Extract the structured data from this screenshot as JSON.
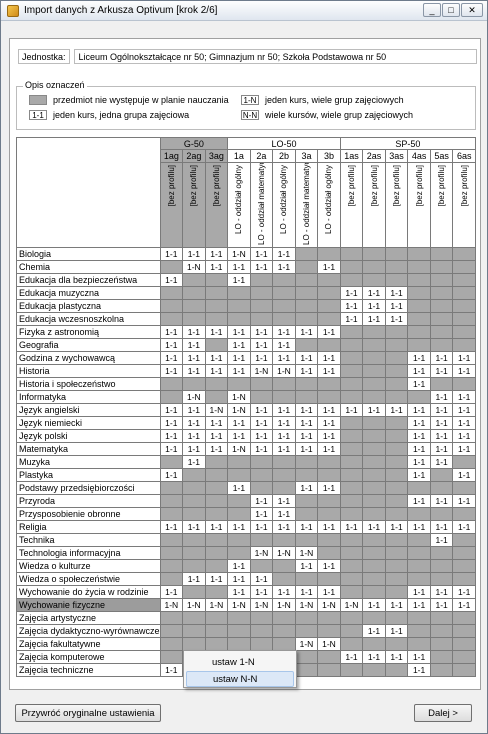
{
  "window": {
    "title": "Import danych z Arkusza Optivum [krok 2/6]",
    "min": "_",
    "max": "□",
    "close": "✕"
  },
  "jednostka": {
    "label": "Jednostka:",
    "value": "Liceum Ogólnokształcące nr 50; Gimnazjum nr 50; Szkoła Podstawowa nr 50"
  },
  "legend": {
    "title": "Opis oznaczeń",
    "grey_text": "przedmiot nie występuje w planie nauczania",
    "one_one_box": "1-1",
    "one_one_text": "jeden kurs, jedna grupa zajęciowa",
    "one_n_box": "1-N",
    "one_n_text": "jeden kurs, wiele grup zajęciowych",
    "n_n_box": "N-N",
    "n_n_text": "wiele kursów, wiele grup zajęciowych"
  },
  "groups": [
    {
      "name": "G-50",
      "span": 3,
      "grey": true
    },
    {
      "name": "LO-50",
      "span": 5,
      "grey": false
    },
    {
      "name": "SP-50",
      "span": 6,
      "grey": false
    }
  ],
  "classes": [
    "1ag",
    "2ag",
    "3ag",
    "1a",
    "2a",
    "2b",
    "3a",
    "3b",
    "1as",
    "2as",
    "3as",
    "4as",
    "5as",
    "6as"
  ],
  "profiles": [
    "[bez profilu]",
    "[bez profilu]",
    "[bez profilu]",
    "LO - oddział ogólny",
    "LO - oddział matematyczny",
    "LO - oddział ogólny",
    "LO - oddział matematyczny",
    "LO - oddział ogólny",
    "[bez profilu]",
    "[bez profilu]",
    "[bez profilu]",
    "[bez profilu]",
    "[bez profilu]",
    "[bez profilu]"
  ],
  "rows": [
    {
      "subject": "Biologia",
      "cells": [
        "1-1",
        "1-1",
        "1-1",
        "1-N",
        "1-1",
        "1-1",
        "",
        "",
        "",
        "",
        "",
        "",
        "",
        ""
      ]
    },
    {
      "subject": "Chemia",
      "cells": [
        "",
        "1-N",
        "1-1",
        "1-1",
        "1-1",
        "1-1",
        "",
        "1-1",
        "",
        "",
        "",
        "",
        "",
        ""
      ]
    },
    {
      "subject": "Edukacja dla bezpieczeństwa",
      "cells": [
        "1-1",
        "",
        "",
        "1-1",
        "",
        "",
        "",
        "",
        "",
        "",
        "",
        "",
        "",
        ""
      ]
    },
    {
      "subject": "Edukacja muzyczna",
      "cells": [
        "",
        "",
        "",
        "",
        "",
        "",
        "",
        "",
        "1-1",
        "1-1",
        "1-1",
        "",
        "",
        ""
      ]
    },
    {
      "subject": "Edukacja plastyczna",
      "cells": [
        "",
        "",
        "",
        "",
        "",
        "",
        "",
        "",
        "1-1",
        "1-1",
        "1-1",
        "",
        "",
        ""
      ]
    },
    {
      "subject": "Edukacja wczesnoszkolna",
      "cells": [
        "",
        "",
        "",
        "",
        "",
        "",
        "",
        "",
        "1-1",
        "1-1",
        "1-1",
        "",
        "",
        ""
      ]
    },
    {
      "subject": "Fizyka z astronomią",
      "cells": [
        "1-1",
        "1-1",
        "1-1",
        "1-1",
        "1-1",
        "1-1",
        "1-1",
        "1-1",
        "",
        "",
        "",
        "",
        "",
        ""
      ]
    },
    {
      "subject": "Geografia",
      "cells": [
        "1-1",
        "1-1",
        "",
        "1-1",
        "1-1",
        "1-1",
        "",
        "",
        "",
        "",
        "",
        "",
        "",
        ""
      ]
    },
    {
      "subject": "Godzina z wychowawcą",
      "cells": [
        "1-1",
        "1-1",
        "1-1",
        "1-1",
        "1-1",
        "1-1",
        "1-1",
        "1-1",
        "",
        "",
        "",
        "1-1",
        "1-1",
        "1-1"
      ]
    },
    {
      "subject": "Historia",
      "cells": [
        "1-1",
        "1-1",
        "1-1",
        "1-1",
        "1-N",
        "1-N",
        "1-1",
        "1-1",
        "",
        "",
        "",
        "1-1",
        "1-1",
        "1-1"
      ]
    },
    {
      "subject": "Historia i społeczeństwo",
      "cells": [
        "",
        "",
        "",
        "",
        "",
        "",
        "",
        "",
        "",
        "",
        "",
        "1-1",
        "",
        ""
      ]
    },
    {
      "subject": "Informatyka",
      "cells": [
        "",
        "1-N",
        "",
        "1-N",
        "",
        "",
        "",
        "",
        "",
        "",
        "",
        "",
        "1-1",
        "1-1"
      ]
    },
    {
      "subject": "Język angielski",
      "cells": [
        "1-1",
        "1-1",
        "1-N",
        "1-N",
        "1-1",
        "1-1",
        "1-1",
        "1-1",
        "1-1",
        "1-1",
        "1-1",
        "1-1",
        "1-1",
        "1-1"
      ]
    },
    {
      "subject": "Język niemiecki",
      "cells": [
        "1-1",
        "1-1",
        "1-1",
        "1-1",
        "1-1",
        "1-1",
        "1-1",
        "1-1",
        "",
        "",
        "",
        "1-1",
        "1-1",
        "1-1"
      ]
    },
    {
      "subject": "Język polski",
      "cells": [
        "1-1",
        "1-1",
        "1-1",
        "1-1",
        "1-1",
        "1-1",
        "1-1",
        "1-1",
        "",
        "",
        "",
        "1-1",
        "1-1",
        "1-1"
      ]
    },
    {
      "subject": "Matematyka",
      "cells": [
        "1-1",
        "1-1",
        "1-1",
        "1-N",
        "1-1",
        "1-1",
        "1-1",
        "1-1",
        "",
        "",
        "",
        "1-1",
        "1-1",
        "1-1"
      ]
    },
    {
      "subject": "Muzyka",
      "cells": [
        "",
        "1-1",
        "",
        "",
        "",
        "",
        "",
        "",
        "",
        "",
        "",
        "1-1",
        "1-1",
        ""
      ]
    },
    {
      "subject": "Plastyka",
      "cells": [
        "1-1",
        "",
        "",
        "",
        "",
        "",
        "",
        "",
        "",
        "",
        "",
        "1-1",
        "",
        "1-1"
      ]
    },
    {
      "subject": "Podstawy przedsiębiorczości",
      "cells": [
        "",
        "",
        "",
        "1-1",
        "",
        "",
        "1-1",
        "1-1",
        "",
        "",
        "",
        "",
        "",
        ""
      ]
    },
    {
      "subject": "Przyroda",
      "cells": [
        "",
        "",
        "",
        "",
        "1-1",
        "1-1",
        "",
        "",
        "",
        "",
        "",
        "1-1",
        "1-1",
        "1-1"
      ]
    },
    {
      "subject": "Przysposobienie obronne",
      "cells": [
        "",
        "",
        "",
        "",
        "1-1",
        "1-1",
        "",
        "",
        "",
        "",
        "",
        "",
        "",
        ""
      ]
    },
    {
      "subject": "Religia",
      "cells": [
        "1-1",
        "1-1",
        "1-1",
        "1-1",
        "1-1",
        "1-1",
        "1-1",
        "1-1",
        "1-1",
        "1-1",
        "1-1",
        "1-1",
        "1-1",
        "1-1"
      ]
    },
    {
      "subject": "Technika",
      "cells": [
        "",
        "",
        "",
        "",
        "",
        "",
        "",
        "",
        "",
        "",
        "",
        "",
        "1-1",
        ""
      ]
    },
    {
      "subject": "Technologia informacyjna",
      "cells": [
        "",
        "",
        "",
        "",
        "1-N",
        "1-N",
        "1-N",
        "",
        "",
        "",
        "",
        "",
        "",
        ""
      ]
    },
    {
      "subject": "Wiedza o kulturze",
      "cells": [
        "",
        "",
        "",
        "1-1",
        "",
        "",
        "1-1",
        "1-1",
        "",
        "",
        "",
        "",
        "",
        ""
      ]
    },
    {
      "subject": "Wiedza o społeczeństwie",
      "cells": [
        "",
        "1-1",
        "1-1",
        "1-1",
        "1-1",
        "",
        "",
        "",
        "",
        "",
        "",
        "",
        "",
        ""
      ]
    },
    {
      "subject": "Wychowanie do życia w rodzinie",
      "cells": [
        "1-1",
        "",
        "",
        "1-1",
        "1-1",
        "1-1",
        "1-1",
        "1-1",
        "",
        "",
        "",
        "1-1",
        "1-1",
        "1-1"
      ]
    },
    {
      "subject": "Wychowanie fizyczne",
      "selected": true,
      "cells": [
        "1-N",
        "1-N",
        "1-N",
        "1-N",
        "1-N",
        "1-N",
        "1-N",
        "1-N",
        "1-N",
        "1-1",
        "1-1",
        "1-1",
        "1-1",
        "1-1"
      ]
    },
    {
      "subject": "Zajęcia artystyczne",
      "cells": [
        "",
        "",
        "",
        "",
        "",
        "",
        "",
        "",
        "",
        "",
        "",
        "",
        "",
        ""
      ]
    },
    {
      "subject": "Zajęcia dydaktyczno-wyrównawcze",
      "cells": [
        "",
        "",
        "",
        "",
        "",
        "",
        "",
        "",
        "",
        "1-1",
        "1-1",
        "",
        "",
        ""
      ]
    },
    {
      "subject": "Zajęcia fakultatywne",
      "cells": [
        "",
        "",
        "",
        "",
        "",
        "",
        "1-N",
        "1-N",
        "",
        "",
        "",
        "",
        "",
        ""
      ]
    },
    {
      "subject": "Zajęcia komputerowe",
      "cells": [
        "",
        "",
        "",
        "",
        "",
        "",
        "",
        "",
        "1-1",
        "1-1",
        "1-1",
        "1-1",
        "",
        ""
      ]
    },
    {
      "subject": "Zajęcia techniczne",
      "cells": [
        "1-1",
        "1-1",
        "1-1",
        "",
        "",
        "",
        "",
        "",
        "",
        "",
        "",
        "1-1",
        "",
        ""
      ]
    }
  ],
  "context_menu": {
    "item1": "ustaw 1-N",
    "item2": "ustaw N-N"
  },
  "buttons": {
    "restore": "Przywróć oryginalne ustawienia",
    "next": "Dalej >"
  }
}
